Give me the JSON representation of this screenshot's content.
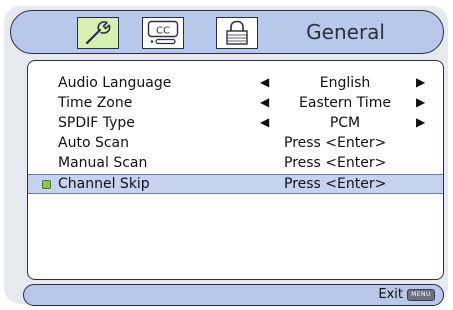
{
  "header": {
    "tabs": [
      {
        "icon": "wrench-icon",
        "active": true
      },
      {
        "icon": "closed-caption-icon",
        "text": "CC",
        "active": false
      },
      {
        "icon": "lock-icon",
        "active": false
      }
    ],
    "title": "General"
  },
  "menu": {
    "items": [
      {
        "label": "Audio Language",
        "value": "English",
        "has_arrows": true,
        "selected": false
      },
      {
        "label": "Time Zone",
        "value": "Eastern Time",
        "has_arrows": true,
        "selected": false
      },
      {
        "label": "SPDIF Type",
        "value": "PCM",
        "has_arrows": true,
        "selected": false
      },
      {
        "label": "Auto Scan",
        "value": "Press <Enter>",
        "has_arrows": false,
        "selected": false
      },
      {
        "label": "Manual Scan",
        "value": "Press <Enter>",
        "has_arrows": false,
        "selected": false
      },
      {
        "label": "Channel Skip",
        "value": "Press <Enter>",
        "has_arrows": false,
        "selected": true
      }
    ]
  },
  "footer": {
    "exit_label": "Exit",
    "menu_key_label": "MENU"
  },
  "colors": {
    "header_bg": "#b8c8ea",
    "active_tab_bg": "#d6f0b4",
    "selected_row_bg": "#c5d3f0",
    "indicator_green": "#8fc458"
  }
}
